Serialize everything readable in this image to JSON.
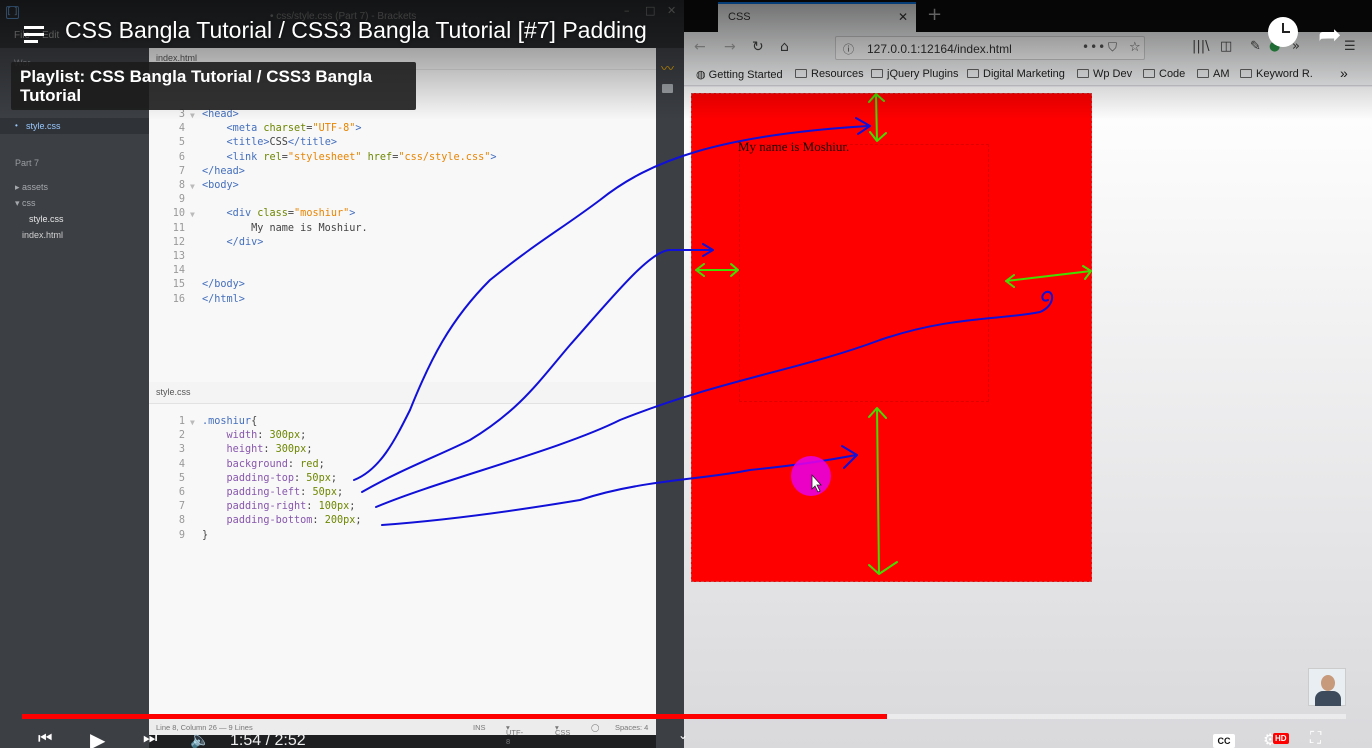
{
  "editor": {
    "window_title": "• css/style.css (Part 7) - Brackets",
    "menu": [
      "File",
      "Edit"
    ],
    "sidebar_head": "Wor",
    "working_file": "style.css",
    "project": "Part 7",
    "tree": [
      "assets",
      "css",
      "style.css",
      "index.html"
    ],
    "top_tab": "index.html",
    "bottom_tab": "style.css",
    "html_lines": [
      {
        "n": "3",
        "html": "<span class=\"tag\">&lt;head&gt;</span>"
      },
      {
        "n": "4",
        "html": "    <span class=\"tag\">&lt;meta</span> <span class=\"attr\">charset</span>=<span class=\"str\">\"UTF-8\"</span><span class=\"tag\">&gt;</span>"
      },
      {
        "n": "5",
        "html": "    <span class=\"tag\">&lt;title&gt;</span>CSS<span class=\"tag\">&lt;/title&gt;</span>"
      },
      {
        "n": "6",
        "html": "    <span class=\"tag\">&lt;link</span> <span class=\"attr\">rel</span>=<span class=\"str\">\"stylesheet\"</span> <span class=\"attr\">href</span>=<span class=\"str\">\"css/style.css\"</span><span class=\"tag\">&gt;</span>"
      },
      {
        "n": "7",
        "html": "<span class=\"tag\">&lt;/head&gt;</span>"
      },
      {
        "n": "8",
        "html": "<span class=\"tag\">&lt;body&gt;</span>"
      },
      {
        "n": "9",
        "html": ""
      },
      {
        "n": "10",
        "html": "    <span class=\"tag\">&lt;div</span> <span class=\"attr\">class</span>=<span class=\"str\">\"moshiur\"</span><span class=\"tag\">&gt;</span>"
      },
      {
        "n": "11",
        "html": "        My name is Moshiur."
      },
      {
        "n": "12",
        "html": "    <span class=\"tag\">&lt;/div&gt;</span>"
      },
      {
        "n": "13",
        "html": ""
      },
      {
        "n": "14",
        "html": ""
      },
      {
        "n": "15",
        "html": "<span class=\"tag\">&lt;/body&gt;</span>"
      },
      {
        "n": "16",
        "html": "<span class=\"tag\">&lt;/html&gt;</span>"
      }
    ],
    "css_lines": [
      {
        "n": "1",
        "html": "<span class=\"sel\">.moshiur</span>{"
      },
      {
        "n": "2",
        "html": "    <span class=\"prop\">width</span>: <span class=\"val\">300px</span>;"
      },
      {
        "n": "3",
        "html": "    <span class=\"prop\">height</span>: <span class=\"val\">300px</span>;"
      },
      {
        "n": "4",
        "html": "    <span class=\"prop\">background</span>: <span class=\"val\">red</span>;"
      },
      {
        "n": "5",
        "html": "    <span class=\"prop\">padding-top</span>: <span class=\"val\">50px</span>;"
      },
      {
        "n": "6",
        "html": "    <span class=\"prop\">padding-left</span>: <span class=\"val\">50px</span>;"
      },
      {
        "n": "7",
        "html": "    <span class=\"prop\">padding-right</span>: <span class=\"val\">100px</span>;"
      },
      {
        "n": "8",
        "html": "    <span class=\"prop\">padding-bottom</span>: <span class=\"val\">200px</span>;"
      },
      {
        "n": "9",
        "html": "}"
      }
    ],
    "status": {
      "cursor": "Line 8, Column 26 — 9 Lines",
      "mode": "INS",
      "encoding": "UTF-8",
      "language": "CSS",
      "spaces": "Spaces: 4"
    }
  },
  "browser": {
    "tab_title": "CSS",
    "url": "127.0.0.1:12164/index.html",
    "bookmarks": [
      "Getting Started",
      "Resources",
      "jQuery Plugins",
      "Digital Marketing",
      "Wp Dev",
      "Code",
      "AM",
      "Keyword R."
    ],
    "page_text": "My name is Moshiur."
  },
  "youtube": {
    "title": "CSS Bangla Tutorial / CSS3 Bangla Tutorial [#7] Padding",
    "playlist": "Playlist: CSS Bangla Tutorial / CSS3 Bangla Tutorial",
    "time": "1:54 / 2:52",
    "progress_fraction": 0.6535,
    "cc_label": "CC",
    "hd_label": "HD"
  },
  "colors": {
    "box": "#ff0000",
    "annotation_blue": "#1010d8",
    "annotation_green": "#44dd00",
    "cursor_highlight": "#e800e8",
    "progress": "#ff0000"
  }
}
